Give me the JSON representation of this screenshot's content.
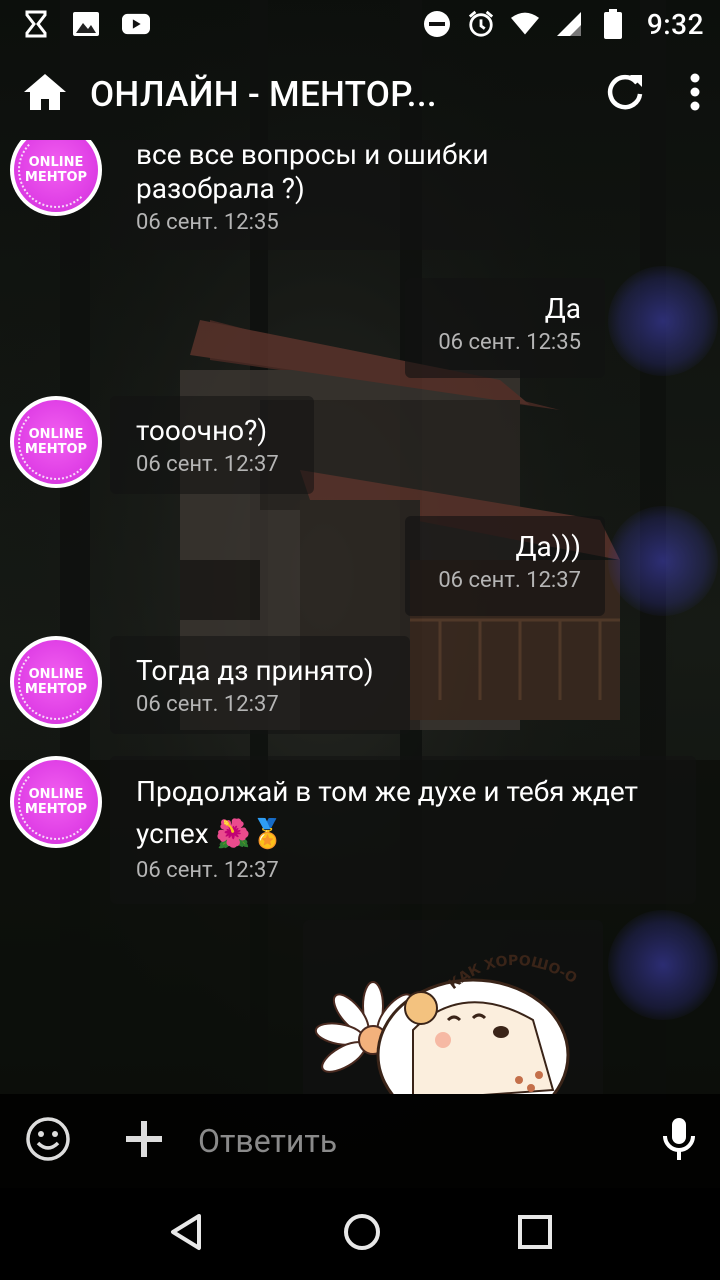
{
  "status_bar": {
    "time": "9:32",
    "left_icons": [
      "hourglass-icon",
      "image-icon",
      "youtube-icon"
    ],
    "right_icons": [
      "do-not-disturb-icon",
      "alarm-icon",
      "wifi-icon",
      "signal-icon",
      "battery-icon"
    ]
  },
  "app_bar": {
    "title": "ОНЛАЙН - МЕНТОР...",
    "home_icon": "home-icon",
    "refresh_icon": "refresh-icon",
    "menu_icon": "more-vert-icon"
  },
  "avatar": {
    "line1": "ONLINE",
    "line2": "МЕНТОР"
  },
  "messages": [
    {
      "direction": "in",
      "text_lines": [
        "все все вопросы и ошибки",
        "разобрала ?)"
      ],
      "time": "06 сент. 12:35"
    },
    {
      "direction": "out",
      "text": "Да",
      "time": "06 сент. 12:35"
    },
    {
      "direction": "in",
      "text": "тооочно?)",
      "time": "06 сент. 12:37"
    },
    {
      "direction": "out",
      "text": "Да)))",
      "time": "06 сент. 12:37"
    },
    {
      "direction": "in",
      "text": "Тогда дз принято)",
      "time": "06 сент. 12:37"
    },
    {
      "direction": "in",
      "text_lines": [
        "Продолжай в том же духе и тебя ждет",
        "успех 🌺🏅"
      ],
      "time": "06 сент. 12:37"
    },
    {
      "direction": "out",
      "sticker_caption": "КАК ХОРОШО-О"
    }
  ],
  "input_bar": {
    "placeholder": "Ответить",
    "emoji_icon": "emoji-icon",
    "add_icon": "plus-icon",
    "mic_icon": "microphone-icon"
  },
  "nav_bar": {
    "icons": [
      "back-icon",
      "home-circle-icon",
      "recents-icon"
    ]
  },
  "colors": {
    "avatar_pink": "#e040e6",
    "timestamp_gray": "#b5b5b5",
    "glow_blue": "#3c3cb4"
  }
}
